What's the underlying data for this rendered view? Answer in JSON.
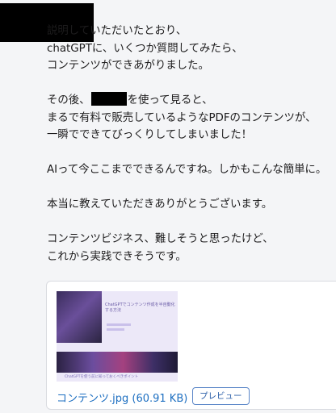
{
  "message": {
    "lines": [
      "説明していただいたとおり、",
      "chatGPTに、いくつか質問してみたら、",
      "コンテンツができあがりました。",
      "",
      " その後、",
      "を使って見ると、",
      "まるで有料で販売しているようなPDFのコンテンツが、",
      "一瞬でできてびっくりしてしまいました！",
      "",
      "AIって今ここまでできるんですね。しかもこんな簡単に。",
      "",
      "本当に教えていただきありがとうございます。",
      "",
      "コンテンツビジネス、難しそうと思ったけど、",
      "これから実践できそうです。"
    ]
  },
  "attachment": {
    "file_name": "コンテンツ.jpg",
    "file_size": "(60.91 KB)",
    "preview_label": "プレビュー",
    "thumbnail": {
      "title": "ChatGPTでコンテンツ作成を半自動化する方法",
      "caption": "ChatGPTを使う前に知っておくべきポイント"
    }
  }
}
